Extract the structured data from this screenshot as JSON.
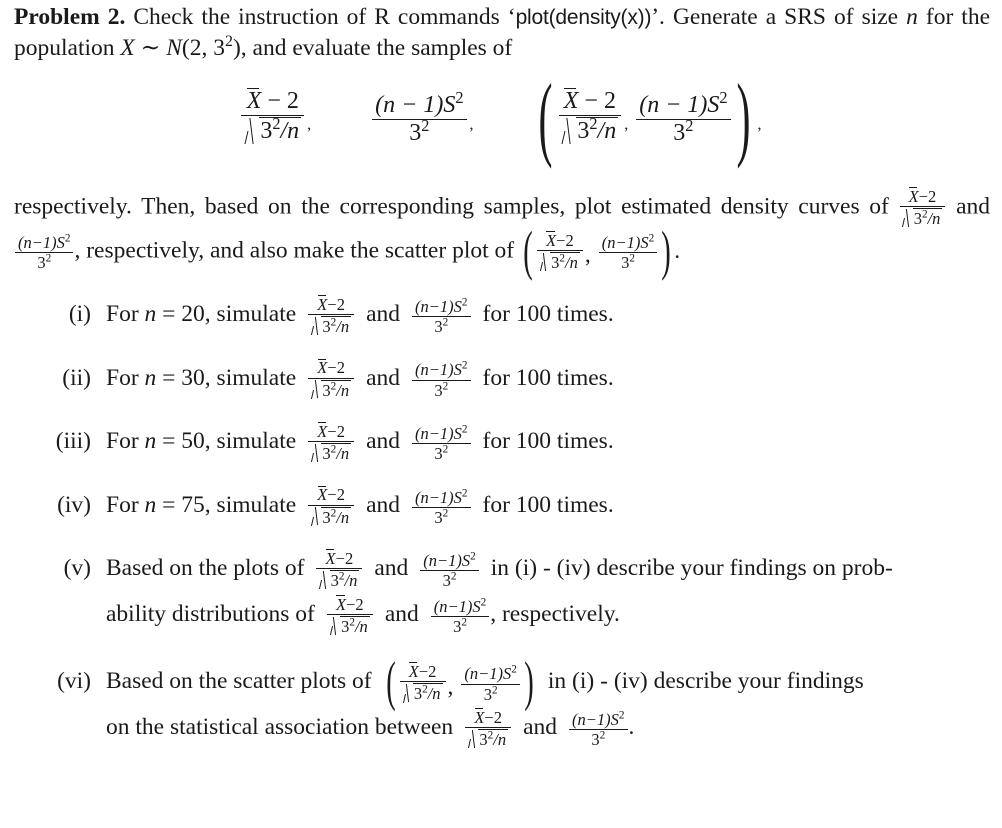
{
  "document": {
    "problem_heading": "Problem 2.",
    "intro": {
      "text_before_code": "Check the instruction of R commands ‘",
      "code": "plot(density(x))",
      "text_after_code": "’. Generate a SRS of size ",
      "var_n": "n",
      "text_population": " for the population ",
      "var_X": "X",
      "sim": "∼",
      "cal_N": "N",
      "dist_args": "(2, 3",
      "dist_exp": "2",
      "dist_close": "), and evaluate the samples of"
    },
    "math_symbols": {
      "x_bar": "X",
      "minus_two": "− 2",
      "minus_two_tight": "−2",
      "sqrt_base": "3",
      "sqrt_exp": "2",
      "sqrt_over_n": "/n",
      "numerator_n_minus_1": "(n − 1)S",
      "numerator_n_minus_1_tight": "(n−1)S",
      "numerator_exp": "2",
      "denominator_three": "3",
      "denominator_exp": "2",
      "comma": ",",
      "paren_open": "(",
      "paren_close": ")"
    },
    "respectively_paragraph": {
      "lead": "respectively. Then, based on the corresponding samples, plot estimated density curves of",
      "and": "and",
      "middle": ", respectively, and also make the scatter plot of",
      "period": "."
    },
    "items": [
      {
        "label": "(i)",
        "prefix": "For ",
        "var_n": "n",
        "equals": " = ",
        "n_value": "20",
        "simulate": ", simulate",
        "and": "and",
        "suffix": "for 100 times."
      },
      {
        "label": "(ii)",
        "prefix": "For ",
        "var_n": "n",
        "equals": " = ",
        "n_value": "30",
        "simulate": ", simulate",
        "and": "and",
        "suffix": "for 100 times."
      },
      {
        "label": "(iii)",
        "prefix": "For ",
        "var_n": "n",
        "equals": " = ",
        "n_value": "50",
        "simulate": ", simulate",
        "and": "and",
        "suffix": "for 100 times."
      },
      {
        "label": "(iv)",
        "prefix": "For ",
        "var_n": "n",
        "equals": " = ",
        "n_value": "75",
        "simulate": ", simulate",
        "and": "and",
        "suffix": "for 100 times."
      }
    ],
    "item_v": {
      "label": "(v)",
      "lead": "Based on the plots of",
      "and": "and",
      "middle": "in (i) - (iv) describe your findings on prob-",
      "line2_lead": "ability distributions of",
      "line2_and": "and",
      "line2_tail": ", respectively."
    },
    "item_vi": {
      "label": "(vi)",
      "lead": "Based on the scatter plots of",
      "middle": "in (i) - (iv) describe your findings",
      "line2_lead": "on the statistical association between",
      "line2_and": "and",
      "line2_tail": "."
    },
    "colors": {
      "text": "#1a1a1a",
      "background": "#ffffff"
    }
  }
}
